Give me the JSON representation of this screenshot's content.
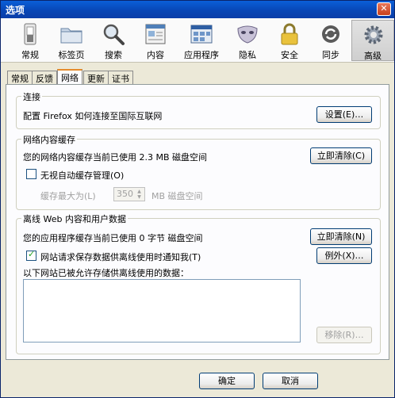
{
  "window": {
    "title": "选项",
    "close_glyph": "✕"
  },
  "toolbar": {
    "items": [
      {
        "label": "常规",
        "icon": "switch-icon"
      },
      {
        "label": "标签页",
        "icon": "folder-icon"
      },
      {
        "label": "搜索",
        "icon": "magnifier-icon"
      },
      {
        "label": "内容",
        "icon": "content-icon"
      },
      {
        "label": "应用程序",
        "icon": "applications-icon"
      },
      {
        "label": "隐私",
        "icon": "mask-icon"
      },
      {
        "label": "安全",
        "icon": "lock-icon"
      },
      {
        "label": "同步",
        "icon": "sync-icon"
      },
      {
        "label": "高级",
        "icon": "gear-icon"
      }
    ],
    "active_index": 8
  },
  "tabs": [
    "常规",
    "反馈",
    "网络",
    "更新",
    "证书"
  ],
  "active_tab": "网络",
  "connection": {
    "legend": "连接",
    "description": "配置 Firefox 如何连接至国际互联网",
    "settings_button": "设置(E)…"
  },
  "cache": {
    "legend": "网络内容缓存",
    "usage_text": "您的网络内容缓存当前已使用 2.3 MB 磁盘空间",
    "clear_button": "立即清除(C)",
    "override_label": "无视自动缓存管理(O)",
    "limit_label": "缓存最大为(L)",
    "limit_value": "350",
    "limit_unit": "MB 磁盘空间"
  },
  "offline": {
    "legend": "离线 Web 内容和用户数据",
    "usage_text": "您的应用程序缓存当前已使用 0 字节 磁盘空间",
    "clear_button": "立即清除(N)",
    "notify_label": "网站请求保存数据供离线使用时通知我(T)",
    "exceptions_button": "例外(X)…",
    "allowed_sites_label": "以下网站已被允许存储供离线使用的数据：",
    "remove_button": "移除(R)…"
  },
  "footer": {
    "ok_button": "确定",
    "cancel_button": "取消"
  }
}
